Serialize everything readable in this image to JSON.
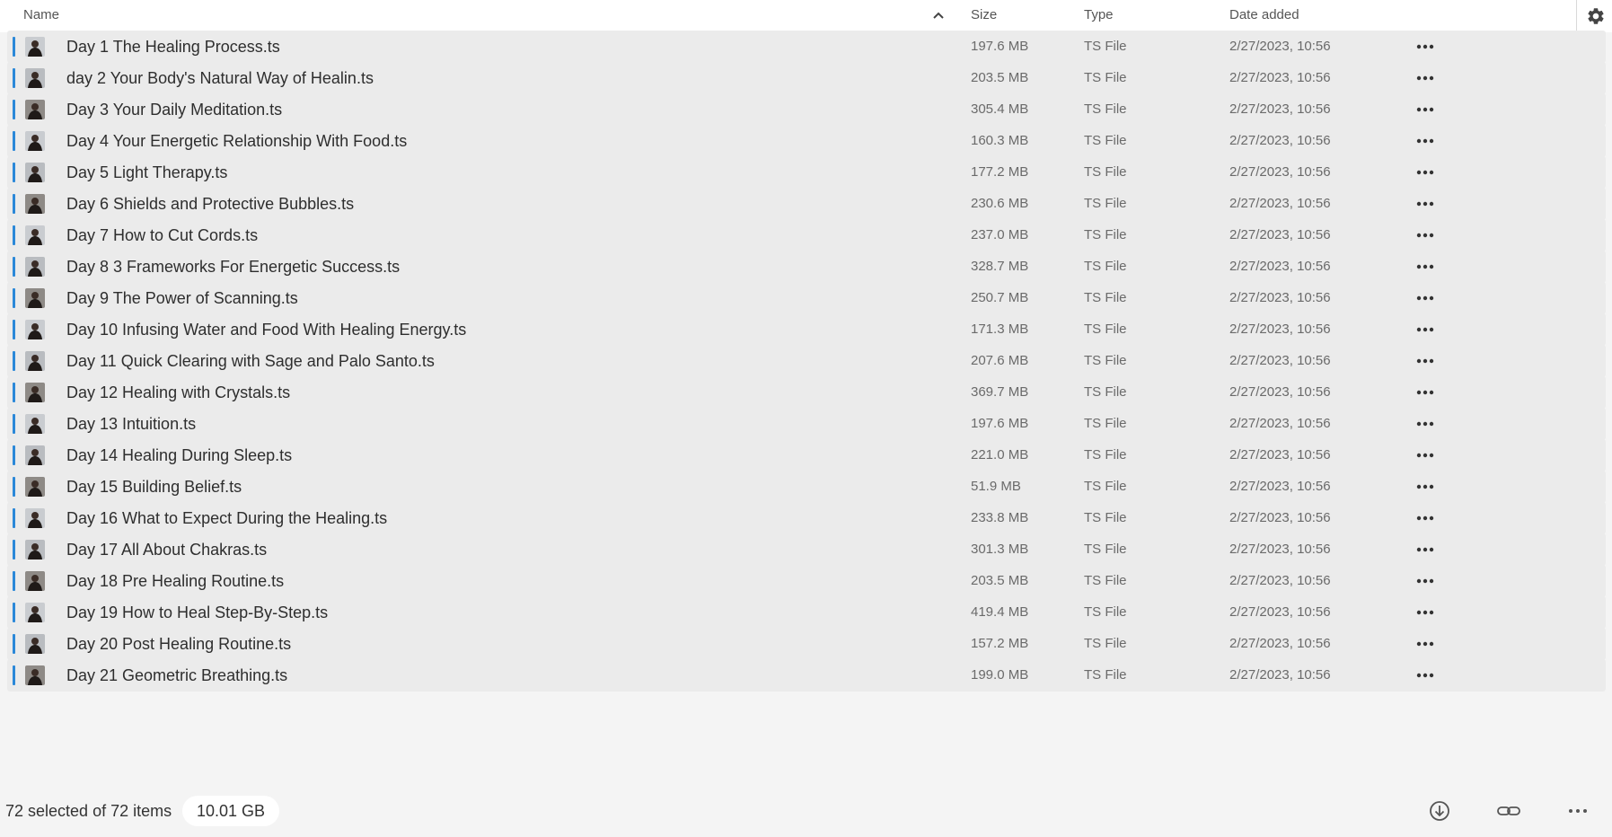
{
  "header": {
    "name_label": "Name",
    "size_label": "Size",
    "type_label": "Type",
    "date_label": "Date added",
    "sort_icon": "chevron-up-icon",
    "settings_icon": "gear-icon"
  },
  "colors": {
    "selection_accent": "#2b88d8",
    "row_background": "#ebebeb",
    "list_background": "#f4f4f4"
  },
  "files": [
    {
      "name": "Day 1 The Healing Process.ts",
      "size": "197.6 MB",
      "type": "TS File",
      "date": "2/27/2023, 10:56"
    },
    {
      "name": "day 2 Your Body's Natural Way of Healin.ts",
      "size": "203.5 MB",
      "type": "TS File",
      "date": "2/27/2023, 10:56"
    },
    {
      "name": "Day 3 Your Daily Meditation.ts",
      "size": "305.4 MB",
      "type": "TS File",
      "date": "2/27/2023, 10:56"
    },
    {
      "name": "Day 4 Your Energetic Relationship With Food.ts",
      "size": "160.3 MB",
      "type": "TS File",
      "date": "2/27/2023, 10:56"
    },
    {
      "name": "Day 5 Light Therapy.ts",
      "size": "177.2 MB",
      "type": "TS File",
      "date": "2/27/2023, 10:56"
    },
    {
      "name": "Day 6 Shields and Protective Bubbles.ts",
      "size": "230.6 MB",
      "type": "TS File",
      "date": "2/27/2023, 10:56"
    },
    {
      "name": "Day 7 How to Cut Cords.ts",
      "size": "237.0 MB",
      "type": "TS File",
      "date": "2/27/2023, 10:56"
    },
    {
      "name": "Day 8 3 Frameworks For Energetic Success.ts",
      "size": "328.7 MB",
      "type": "TS File",
      "date": "2/27/2023, 10:56"
    },
    {
      "name": "Day 9 The Power of Scanning.ts",
      "size": "250.7 MB",
      "type": "TS File",
      "date": "2/27/2023, 10:56"
    },
    {
      "name": "Day 10 Infusing Water and Food With Healing Energy.ts",
      "size": "171.3 MB",
      "type": "TS File",
      "date": "2/27/2023, 10:56"
    },
    {
      "name": "Day 11 Quick Clearing with Sage and Palo Santo.ts",
      "size": "207.6 MB",
      "type": "TS File",
      "date": "2/27/2023, 10:56"
    },
    {
      "name": "Day 12 Healing with Crystals.ts",
      "size": "369.7 MB",
      "type": "TS File",
      "date": "2/27/2023, 10:56"
    },
    {
      "name": "Day 13 Intuition.ts",
      "size": "197.6 MB",
      "type": "TS File",
      "date": "2/27/2023, 10:56"
    },
    {
      "name": "Day 14 Healing During Sleep.ts",
      "size": "221.0 MB",
      "type": "TS File",
      "date": "2/27/2023, 10:56"
    },
    {
      "name": "Day 15 Building Belief.ts",
      "size": "51.9 MB",
      "type": "TS File",
      "date": "2/27/2023, 10:56"
    },
    {
      "name": "Day 16 What to Expect During the Healing.ts",
      "size": "233.8 MB",
      "type": "TS File",
      "date": "2/27/2023, 10:56"
    },
    {
      "name": "Day 17 All About Chakras.ts",
      "size": "301.3 MB",
      "type": "TS File",
      "date": "2/27/2023, 10:56"
    },
    {
      "name": "Day 18 Pre Healing Routine.ts",
      "size": "203.5 MB",
      "type": "TS File",
      "date": "2/27/2023, 10:56"
    },
    {
      "name": "Day 19 How to Heal Step-By-Step.ts",
      "size": "419.4 MB",
      "type": "TS File",
      "date": "2/27/2023, 10:56"
    },
    {
      "name": "Day 20 Post Healing Routine.ts",
      "size": "157.2 MB",
      "type": "TS File",
      "date": "2/27/2023, 10:56"
    },
    {
      "name": "Day 21 Geometric Breathing.ts",
      "size": "199.0 MB",
      "type": "TS File",
      "date": "2/27/2023, 10:56"
    }
  ],
  "row_icons": {
    "thumbnail": "video-thumbnail",
    "more": "more-options-icon"
  },
  "footer": {
    "selection_text": "72 selected of 72 items",
    "total_size": "10.01 GB",
    "download_icon": "download-icon",
    "link_icon": "link-icon",
    "more_icon": "more-options-icon"
  }
}
